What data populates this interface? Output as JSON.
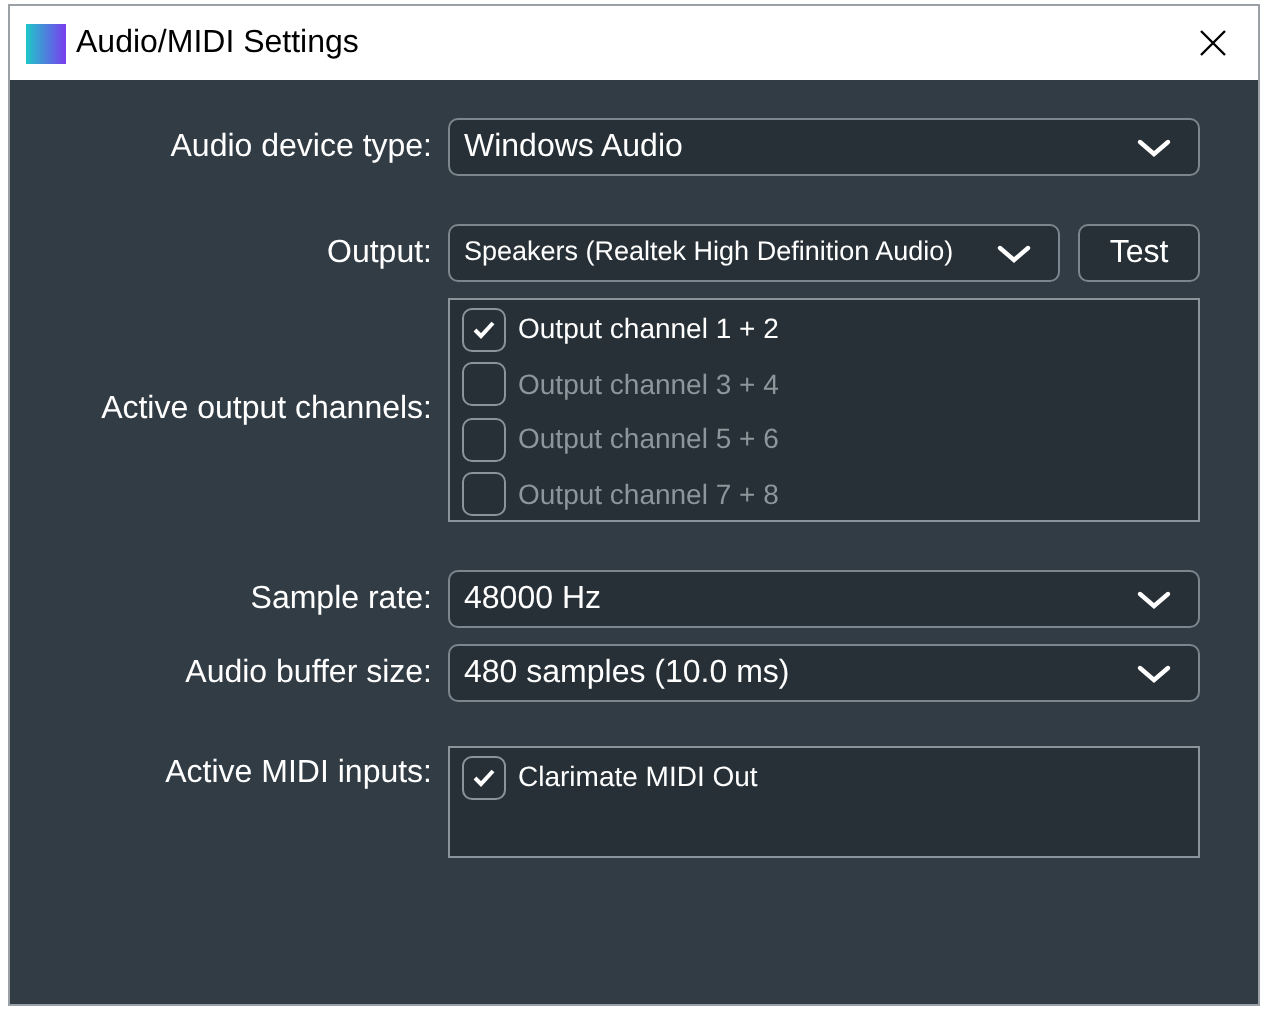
{
  "window": {
    "title": "Audio/MIDI Settings"
  },
  "audio_device_type": {
    "label": "Audio device type:",
    "value": "Windows Audio"
  },
  "output": {
    "label": "Output:",
    "value": "Speakers (Realtek High Definition Audio)",
    "test_button": "Test"
  },
  "active_output_channels": {
    "label": "Active output channels:",
    "items": [
      {
        "label": "Output channel 1 + 2",
        "checked": true
      },
      {
        "label": "Output channel 3 + 4",
        "checked": false
      },
      {
        "label": "Output channel 5 + 6",
        "checked": false
      },
      {
        "label": "Output channel 7 + 8",
        "checked": false
      }
    ]
  },
  "sample_rate": {
    "label": "Sample rate:",
    "value": "48000 Hz"
  },
  "audio_buffer_size": {
    "label": "Audio buffer size:",
    "value": "480 samples (10.0 ms)"
  },
  "active_midi_inputs": {
    "label": "Active MIDI inputs:",
    "items": [
      {
        "label": "Clarimate MIDI Out",
        "checked": true
      }
    ]
  }
}
